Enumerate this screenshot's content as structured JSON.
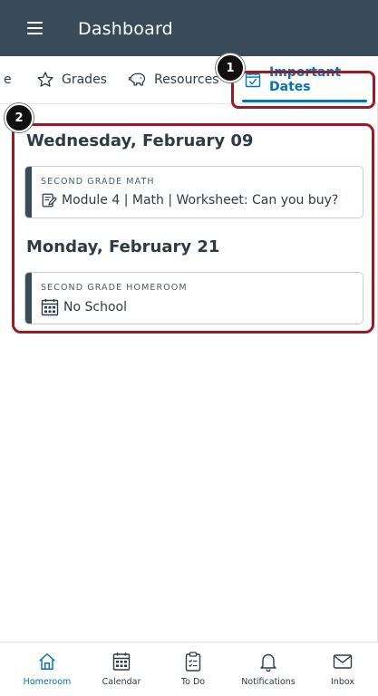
{
  "header": {
    "title": "Dashboard"
  },
  "tabs": [
    {
      "label": "e"
    },
    {
      "label": "Grades"
    },
    {
      "label": "Resources"
    },
    {
      "label": "Important Dates",
      "selected": true
    }
  ],
  "callouts": {
    "one": "1",
    "two": "2"
  },
  "important_dates": [
    {
      "date": "Wednesday, February 09",
      "items": [
        {
          "course": "SECOND GRADE MATH",
          "title": "Module 4 | Math |  Worksheet: Can you buy?",
          "icon": "assignment-icon"
        }
      ]
    },
    {
      "date": "Monday, February 21",
      "items": [
        {
          "course": "SECOND GRADE HOMEROOM",
          "title": "No School",
          "icon": "calendar-event-icon"
        }
      ]
    }
  ],
  "bottom_nav": [
    {
      "label": "Homeroom",
      "icon": "home-icon",
      "active": true
    },
    {
      "label": "Calendar",
      "icon": "calendar-icon"
    },
    {
      "label": "To Do",
      "icon": "todo-icon"
    },
    {
      "label": "Notifications",
      "icon": "bell-icon"
    },
    {
      "label": "Inbox",
      "icon": "mail-icon"
    }
  ],
  "colors": {
    "header_bg": "#394b58",
    "accent": "#0374b5",
    "callout_border": "#9b1b25"
  }
}
